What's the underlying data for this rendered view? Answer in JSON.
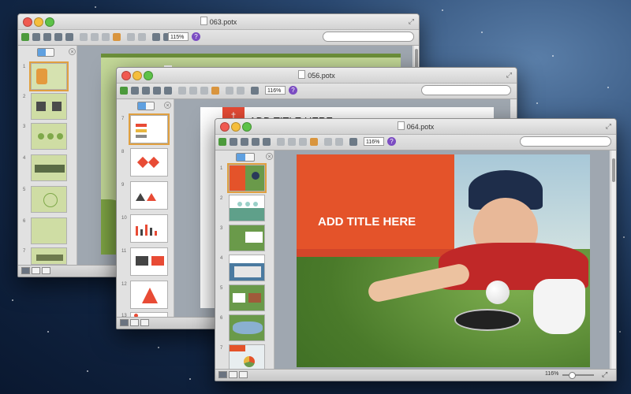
{
  "windows": {
    "w063": {
      "title": "063.potx",
      "zoom": "115%"
    },
    "w056": {
      "title": "056.potx",
      "zoom": "116%",
      "slide_title": "ADD TITLE HERE"
    },
    "w064": {
      "title": "064.potx",
      "zoom": "116%",
      "slide_title": "ADD TITLE HERE",
      "status_zoom": "116%"
    }
  },
  "slide_numbers": {
    "w063": [
      "1",
      "2",
      "3",
      "4",
      "5",
      "6",
      "7"
    ],
    "w056": [
      "7",
      "8",
      "9",
      "10",
      "11",
      "12",
      "13"
    ],
    "w064": [
      "1",
      "2",
      "3",
      "4",
      "5",
      "6",
      "7"
    ]
  },
  "colors": {
    "accent_orange": "#e4532a",
    "template_green": "#c4d998",
    "template_red": "#e84b35",
    "selection": "#e0a040"
  }
}
